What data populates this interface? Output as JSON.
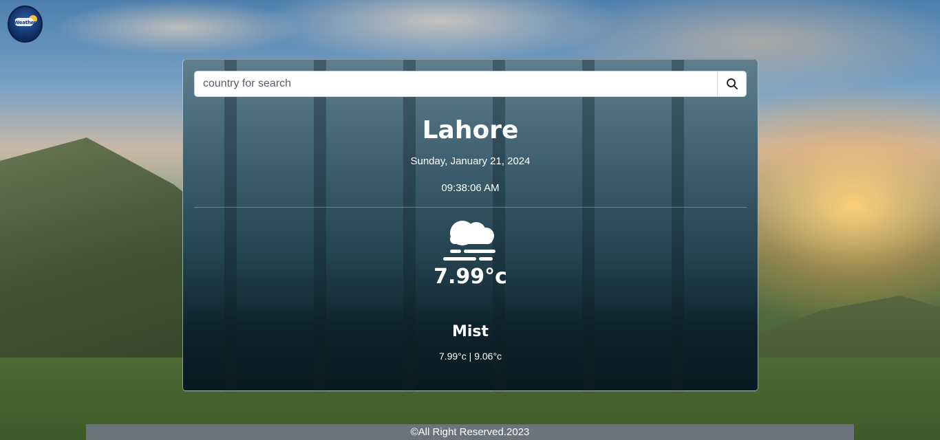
{
  "logo": {
    "text": "Weather",
    "icon": "weather-logo-icon"
  },
  "search": {
    "placeholder": "country for search",
    "value": "",
    "icon": "search-icon"
  },
  "weather": {
    "city": "Lahore",
    "date": "Sunday, January 21, 2024",
    "time": "09:38:06 AM",
    "icon": "mist-icon",
    "temperature": "7.99°c",
    "condition": "Mist",
    "range": "7.99°c | 9.06°c"
  },
  "footer": {
    "text": "©All Right Reserved.2023"
  }
}
